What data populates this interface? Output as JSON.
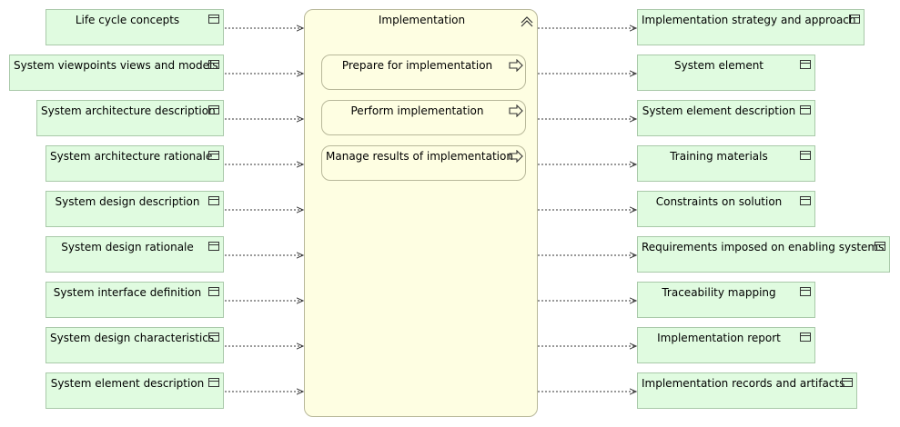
{
  "process": {
    "title": "Implementation",
    "steps": [
      {
        "label": "Prepare for implementation"
      },
      {
        "label": "Perform implementation"
      },
      {
        "label": "Manage results of implementation"
      }
    ]
  },
  "inputs": [
    {
      "label": "Life cycle concepts"
    },
    {
      "label": "System viewpoints views and models"
    },
    {
      "label": "System architecture description"
    },
    {
      "label": "System architecture rationale"
    },
    {
      "label": "System design description"
    },
    {
      "label": "System design rationale"
    },
    {
      "label": "System interface definition"
    },
    {
      "label": "System design characteristics"
    },
    {
      "label": "System element description"
    }
  ],
  "outputs": [
    {
      "label": "Implementation strategy and approach"
    },
    {
      "label": "System element"
    },
    {
      "label": "System element description"
    },
    {
      "label": "Training materials"
    },
    {
      "label": "Constraints on solution"
    },
    {
      "label": "Requirements imposed on enabling systems"
    },
    {
      "label": "Traceability mapping"
    },
    {
      "label": "Implementation report"
    },
    {
      "label": "Implementation records and artifacts"
    }
  ]
}
